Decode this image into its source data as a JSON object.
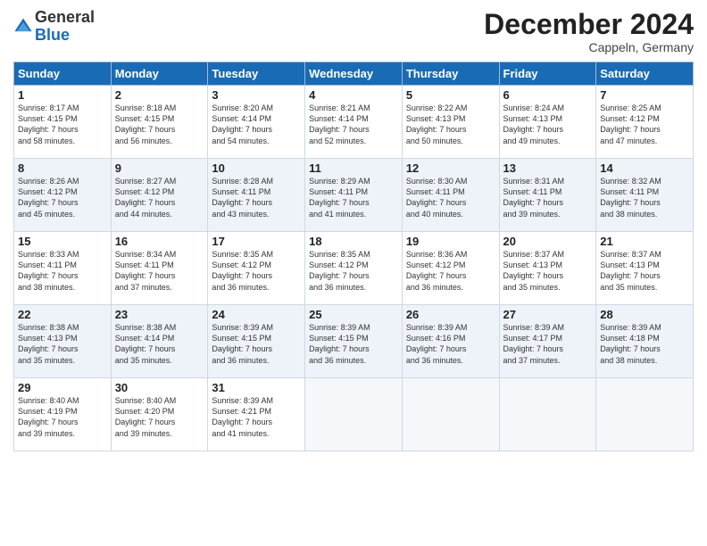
{
  "logo": {
    "general": "General",
    "blue": "Blue"
  },
  "header": {
    "title": "December 2024",
    "subtitle": "Cappeln, Germany"
  },
  "columns": [
    "Sunday",
    "Monday",
    "Tuesday",
    "Wednesday",
    "Thursday",
    "Friday",
    "Saturday"
  ],
  "weeks": [
    [
      {
        "day": "1",
        "sunrise": "8:17 AM",
        "sunset": "4:15 PM",
        "daylight": "7 hours and 58 minutes."
      },
      {
        "day": "2",
        "sunrise": "8:18 AM",
        "sunset": "4:15 PM",
        "daylight": "7 hours and 56 minutes."
      },
      {
        "day": "3",
        "sunrise": "8:20 AM",
        "sunset": "4:14 PM",
        "daylight": "7 hours and 54 minutes."
      },
      {
        "day": "4",
        "sunrise": "8:21 AM",
        "sunset": "4:14 PM",
        "daylight": "7 hours and 52 minutes."
      },
      {
        "day": "5",
        "sunrise": "8:22 AM",
        "sunset": "4:13 PM",
        "daylight": "7 hours and 50 minutes."
      },
      {
        "day": "6",
        "sunrise": "8:24 AM",
        "sunset": "4:13 PM",
        "daylight": "7 hours and 49 minutes."
      },
      {
        "day": "7",
        "sunrise": "8:25 AM",
        "sunset": "4:12 PM",
        "daylight": "7 hours and 47 minutes."
      }
    ],
    [
      {
        "day": "8",
        "sunrise": "8:26 AM",
        "sunset": "4:12 PM",
        "daylight": "7 hours and 45 minutes."
      },
      {
        "day": "9",
        "sunrise": "8:27 AM",
        "sunset": "4:12 PM",
        "daylight": "7 hours and 44 minutes."
      },
      {
        "day": "10",
        "sunrise": "8:28 AM",
        "sunset": "4:11 PM",
        "daylight": "7 hours and 43 minutes."
      },
      {
        "day": "11",
        "sunrise": "8:29 AM",
        "sunset": "4:11 PM",
        "daylight": "7 hours and 41 minutes."
      },
      {
        "day": "12",
        "sunrise": "8:30 AM",
        "sunset": "4:11 PM",
        "daylight": "7 hours and 40 minutes."
      },
      {
        "day": "13",
        "sunrise": "8:31 AM",
        "sunset": "4:11 PM",
        "daylight": "7 hours and 39 minutes."
      },
      {
        "day": "14",
        "sunrise": "8:32 AM",
        "sunset": "4:11 PM",
        "daylight": "7 hours and 38 minutes."
      }
    ],
    [
      {
        "day": "15",
        "sunrise": "8:33 AM",
        "sunset": "4:11 PM",
        "daylight": "7 hours and 38 minutes."
      },
      {
        "day": "16",
        "sunrise": "8:34 AM",
        "sunset": "4:11 PM",
        "daylight": "7 hours and 37 minutes."
      },
      {
        "day": "17",
        "sunrise": "8:35 AM",
        "sunset": "4:12 PM",
        "daylight": "7 hours and 36 minutes."
      },
      {
        "day": "18",
        "sunrise": "8:35 AM",
        "sunset": "4:12 PM",
        "daylight": "7 hours and 36 minutes."
      },
      {
        "day": "19",
        "sunrise": "8:36 AM",
        "sunset": "4:12 PM",
        "daylight": "7 hours and 36 minutes."
      },
      {
        "day": "20",
        "sunrise": "8:37 AM",
        "sunset": "4:13 PM",
        "daylight": "7 hours and 35 minutes."
      },
      {
        "day": "21",
        "sunrise": "8:37 AM",
        "sunset": "4:13 PM",
        "daylight": "7 hours and 35 minutes."
      }
    ],
    [
      {
        "day": "22",
        "sunrise": "8:38 AM",
        "sunset": "4:13 PM",
        "daylight": "7 hours and 35 minutes."
      },
      {
        "day": "23",
        "sunrise": "8:38 AM",
        "sunset": "4:14 PM",
        "daylight": "7 hours and 35 minutes."
      },
      {
        "day": "24",
        "sunrise": "8:39 AM",
        "sunset": "4:15 PM",
        "daylight": "7 hours and 36 minutes."
      },
      {
        "day": "25",
        "sunrise": "8:39 AM",
        "sunset": "4:15 PM",
        "daylight": "7 hours and 36 minutes."
      },
      {
        "day": "26",
        "sunrise": "8:39 AM",
        "sunset": "4:16 PM",
        "daylight": "7 hours and 36 minutes."
      },
      {
        "day": "27",
        "sunrise": "8:39 AM",
        "sunset": "4:17 PM",
        "daylight": "7 hours and 37 minutes."
      },
      {
        "day": "28",
        "sunrise": "8:39 AM",
        "sunset": "4:18 PM",
        "daylight": "7 hours and 38 minutes."
      }
    ],
    [
      {
        "day": "29",
        "sunrise": "8:40 AM",
        "sunset": "4:19 PM",
        "daylight": "7 hours and 39 minutes."
      },
      {
        "day": "30",
        "sunrise": "8:40 AM",
        "sunset": "4:20 PM",
        "daylight": "7 hours and 39 minutes."
      },
      {
        "day": "31",
        "sunrise": "8:39 AM",
        "sunset": "4:21 PM",
        "daylight": "7 hours and 41 minutes."
      },
      null,
      null,
      null,
      null
    ]
  ],
  "labels": {
    "sunrise": "Sunrise:",
    "sunset": "Sunset:",
    "daylight": "Daylight:"
  }
}
